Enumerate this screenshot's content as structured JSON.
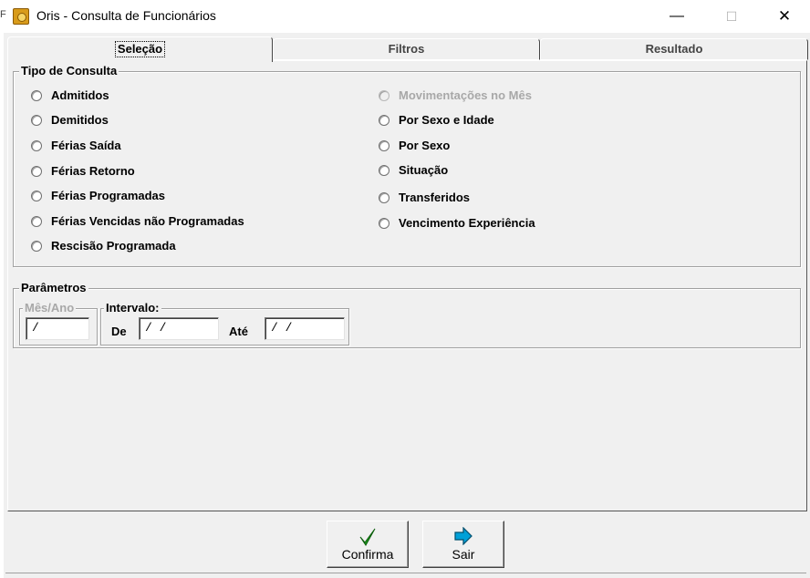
{
  "window": {
    "title": "Oris - Consulta de Funcionários",
    "left_mark": "F",
    "minimize_glyph": "—",
    "maximize_glyph": "☐",
    "close_glyph": "✕"
  },
  "tabs": [
    {
      "label": "Seleção",
      "active": true
    },
    {
      "label": "Filtros",
      "active": false
    },
    {
      "label": "Resultado",
      "active": false
    }
  ],
  "tipo_consulta": {
    "legend": "Tipo de Consulta",
    "left_options": [
      {
        "label": "Admitidos",
        "enabled": true
      },
      {
        "label": "Demitidos",
        "enabled": true
      },
      {
        "label": "Férias Saída",
        "enabled": true
      },
      {
        "label": "Férias Retorno",
        "enabled": true
      },
      {
        "label": "Férias Programadas",
        "enabled": true
      },
      {
        "label": "Férias Vencidas não Programadas",
        "enabled": true
      },
      {
        "label": "Rescisão Programada",
        "enabled": true
      }
    ],
    "right_options": [
      {
        "label": "Movimentações no Mês",
        "enabled": false
      },
      {
        "label": "Por Sexo e Idade",
        "enabled": true
      },
      {
        "label": "Por Sexo",
        "enabled": true
      },
      {
        "label": "Situação",
        "enabled": true
      },
      {
        "label": "Transferidos",
        "enabled": true
      },
      {
        "label": "Vencimento Experiência",
        "enabled": true
      }
    ]
  },
  "parametros": {
    "legend": "Parâmetros",
    "mes_ano": {
      "legend": "Mês/Ano",
      "value": " /"
    },
    "intervalo": {
      "legend": "Intervalo:",
      "de_label": "De",
      "de_value": " / /",
      "ate_label": "Até",
      "ate_value": " / /"
    }
  },
  "buttons": {
    "confirma": {
      "label": "Confirma",
      "icon": "checkmark-icon",
      "icon_color": "#1e9a1e"
    },
    "sair": {
      "label": "Sair",
      "icon": "arrow-right-icon",
      "icon_color": "#00a0d8"
    }
  },
  "colors": {
    "window_bg": "#f0f0f0",
    "disabled_text": "#a8a8a8",
    "app_icon": "#d89b1a"
  }
}
